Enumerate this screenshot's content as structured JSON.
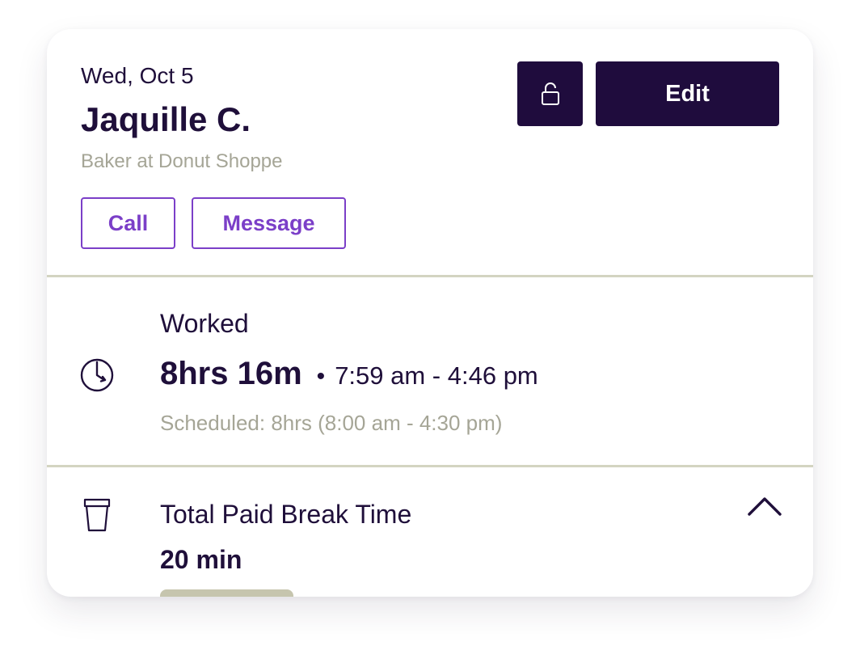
{
  "header": {
    "date": "Wed, Oct 5",
    "name": "Jaquille C.",
    "role": "Baker at Donut Shoppe",
    "call_label": "Call",
    "message_label": "Message",
    "edit_label": "Edit",
    "lock_icon": "unlock-icon"
  },
  "worked": {
    "label": "Worked",
    "total": "8hrs 16m",
    "separator": "•",
    "range": "7:59 am - 4:46 pm",
    "scheduled": "Scheduled: 8hrs (8:00 am - 4:30 pm)",
    "icon": "clock-icon"
  },
  "break": {
    "label": "Total Paid Break Time",
    "value": "20 min",
    "icon": "cup-icon",
    "toggle_icon": "chevron-up-icon"
  },
  "colors": {
    "primary_dark": "#1f0c3d",
    "accent_purple": "#7b3fc8",
    "muted_text": "#a5a596",
    "divider": "#d3d4c1"
  }
}
